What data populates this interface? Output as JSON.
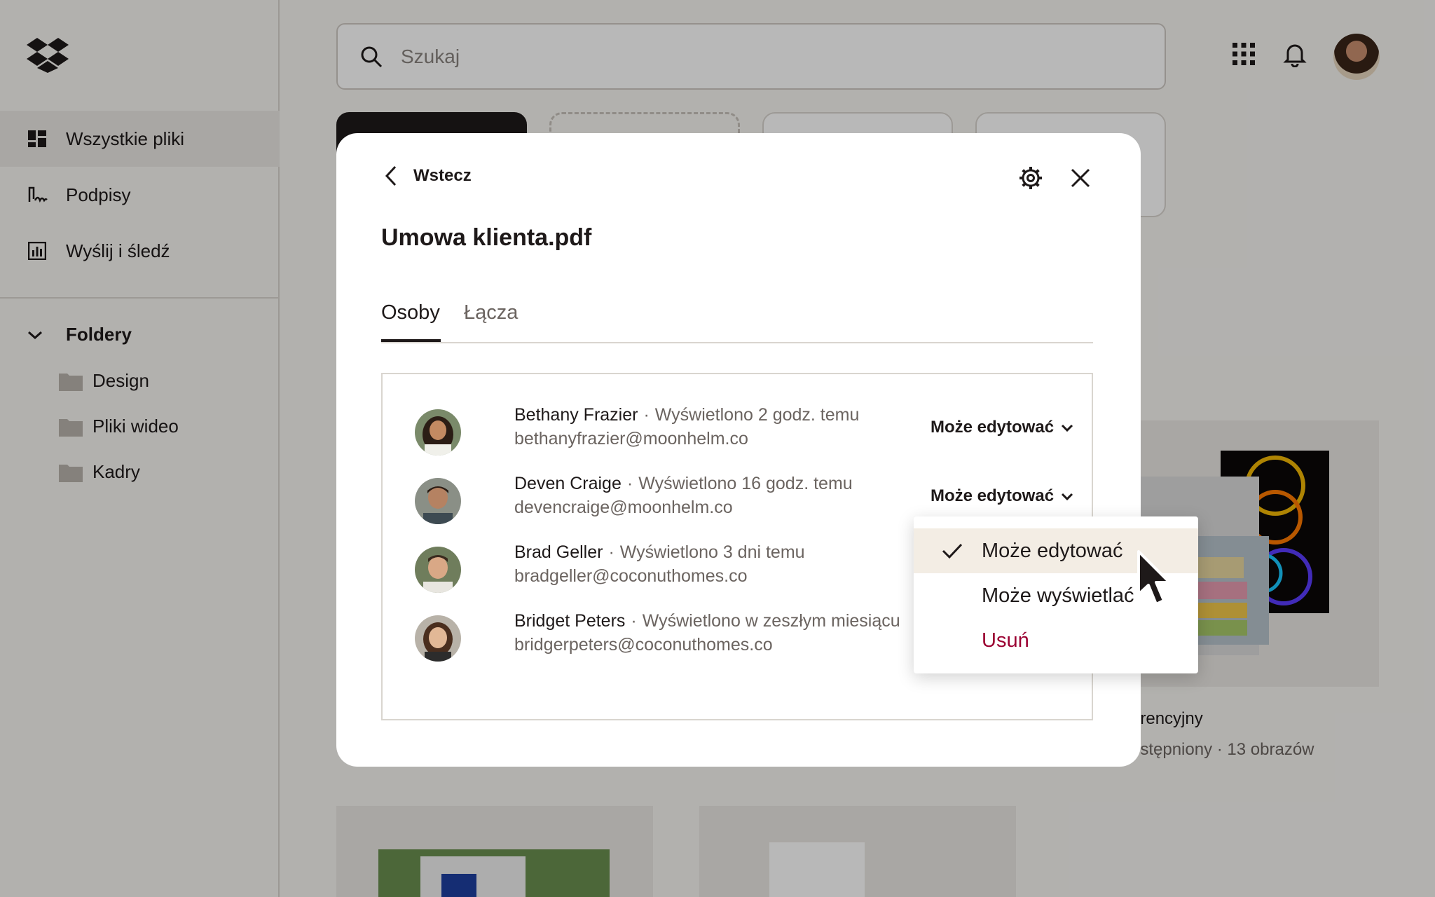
{
  "sidebar": {
    "items": [
      {
        "label": "Wszystkie pliki",
        "icon": "all-files-icon"
      },
      {
        "label": "Podpisy",
        "icon": "signature-icon"
      },
      {
        "label": "Wyślij i śledź",
        "icon": "chart-icon"
      }
    ],
    "folders_label": "Foldery",
    "folders": [
      "Design",
      "Pliki wideo",
      "Kadry"
    ]
  },
  "search": {
    "placeholder": "Szukaj"
  },
  "background": {
    "card_title_partial": "erencyjny",
    "card_meta_partial": "ostępniony · 13 obrazów"
  },
  "modal": {
    "back_label": "Wstecz",
    "title": "Umowa klienta.pdf",
    "tabs": [
      "Osoby",
      "Łącza"
    ],
    "people": [
      {
        "name": "Bethany Frazier",
        "viewed": "Wyświetlono 2 godz. temu",
        "email": "bethanyfrazier@moonhelm.co",
        "permission": "Może edytować"
      },
      {
        "name": "Deven Craige",
        "viewed": "Wyświetlono 16 godz. temu",
        "email": "devencraige@moonhelm.co",
        "permission": "Może edytować"
      },
      {
        "name": "Brad Geller",
        "viewed": "Wyświetlono 3 dni temu",
        "email": "bradgeller@coconuthomes.co",
        "permission": ""
      },
      {
        "name": "Bridget Peters",
        "viewed": "Wyświetlono w zeszłym miesiącu",
        "email": "bridgerpeters@coconuthomes.co",
        "permission": ""
      }
    ]
  },
  "dropdown": {
    "options": [
      {
        "label": "Może edytować",
        "selected": true
      },
      {
        "label": "Może wyświetlać",
        "selected": false
      },
      {
        "label": "Usuń",
        "danger": true
      }
    ]
  },
  "colors": {
    "accent_danger": "#9b0032",
    "text": "#1e1919",
    "muted": "#6b6460",
    "selected_bg": "#f3ede4"
  }
}
